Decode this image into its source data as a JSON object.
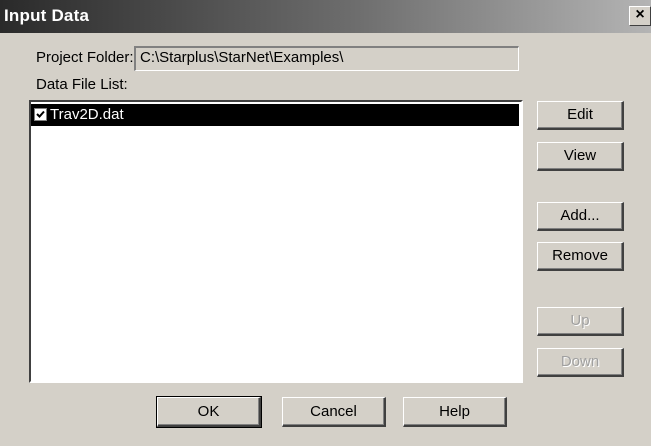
{
  "window": {
    "title": "Input Data",
    "close_label": "×"
  },
  "project": {
    "label": "Project Folder:",
    "value": "C:\\Starplus\\StarNet\\Examples\\"
  },
  "data_files": {
    "label": "Data File List:",
    "items": [
      {
        "name": "Trav2D.dat",
        "checked": true,
        "selected": true
      }
    ]
  },
  "side_buttons": {
    "edit": "Edit",
    "view": "View",
    "add": "Add...",
    "remove": "Remove",
    "up": "Up",
    "down": "Down"
  },
  "bottom_buttons": {
    "ok": "OK",
    "cancel": "Cancel",
    "help": "Help"
  },
  "colors": {
    "face": "#d4d0c8",
    "selection": "#000000",
    "disabled_text": "#a0a0a0"
  }
}
